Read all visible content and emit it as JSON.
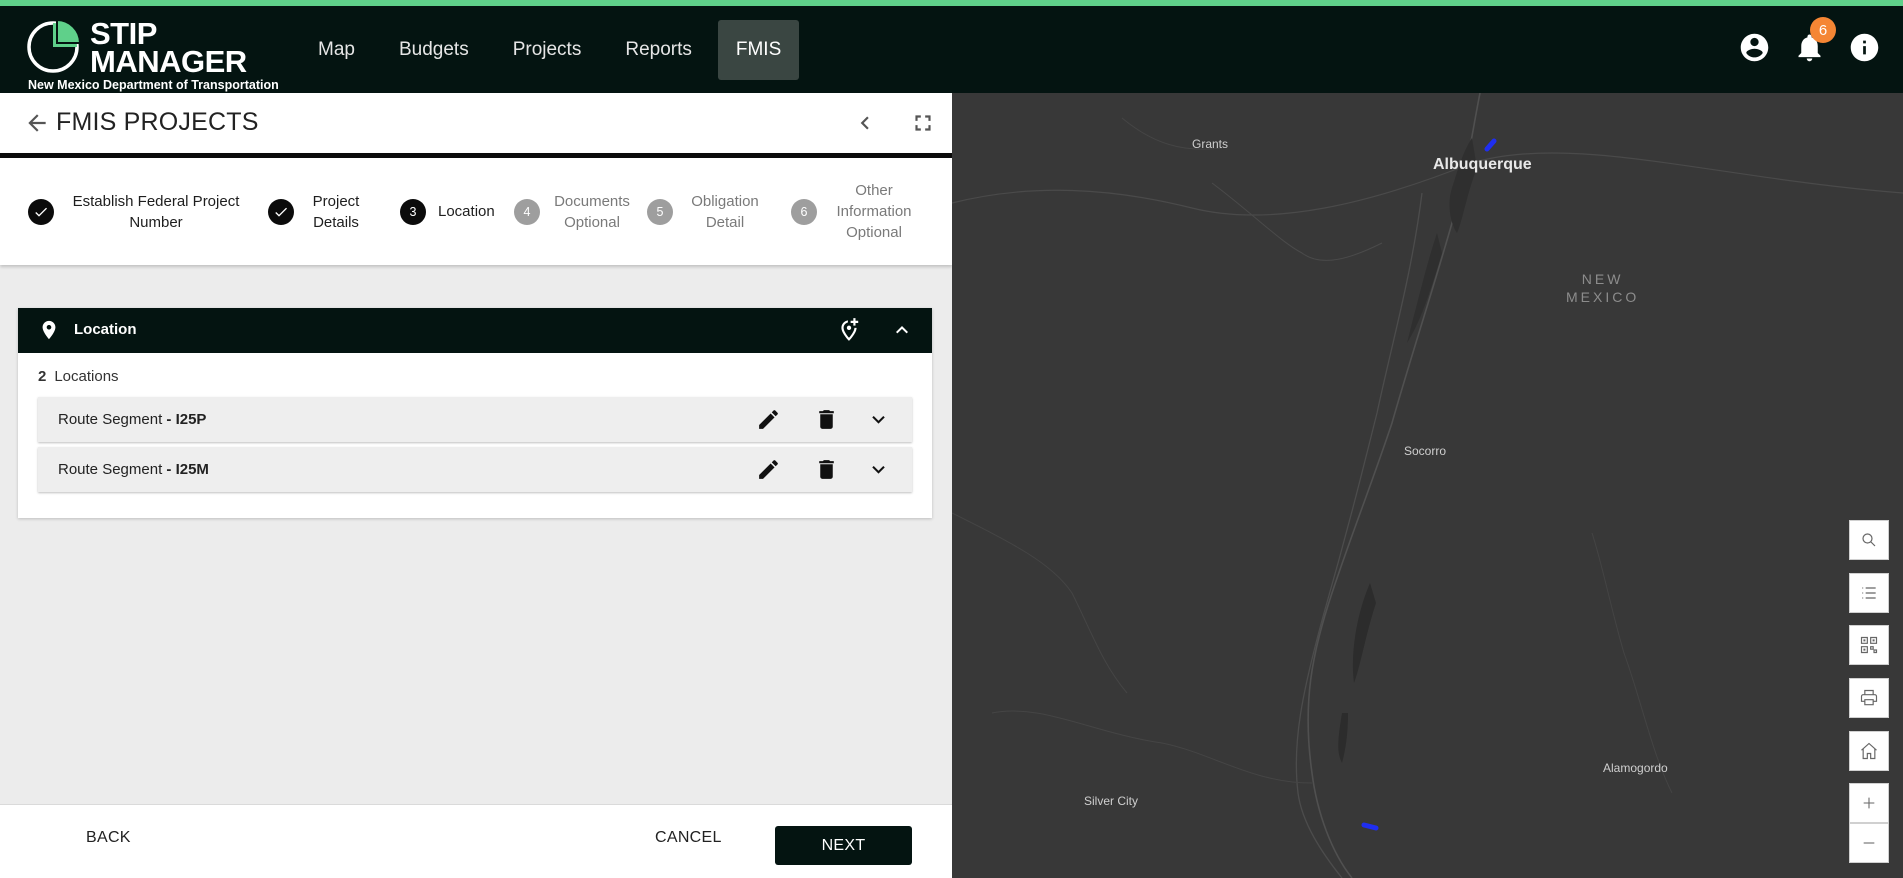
{
  "colors": {
    "brand_dark": "#041411",
    "accent_green": "#5fd08a",
    "badge_orange": "#f58634"
  },
  "app": {
    "logo_title_line1": "STIP",
    "logo_title_line2": "MANAGER",
    "logo_subtitle": "New Mexico Department of Transportation"
  },
  "nav": {
    "items": [
      {
        "label": "Map"
      },
      {
        "label": "Budgets"
      },
      {
        "label": "Projects"
      },
      {
        "label": "Reports"
      },
      {
        "label": "FMIS",
        "active": true
      }
    ]
  },
  "header_icons": {
    "account": "account-circle-icon",
    "notifications": "bell-icon",
    "notification_count": "6",
    "info": "info-icon"
  },
  "panel": {
    "title": "FMIS PROJECTS"
  },
  "steps": [
    {
      "number": "1",
      "label": "Establish Federal Project Number",
      "state": "done"
    },
    {
      "number": "2",
      "label": "Project Details",
      "state": "done"
    },
    {
      "number": "3",
      "label": "Location",
      "state": "current"
    },
    {
      "number": "4",
      "label": "Documents",
      "sub": "Optional",
      "state": "pending"
    },
    {
      "number": "5",
      "label": "Obligation Detail",
      "state": "pending"
    },
    {
      "number": "6",
      "label": "Other Information",
      "sub": "Optional",
      "state": "pending"
    }
  ],
  "location": {
    "header": "Location",
    "count": "2",
    "count_label": "Locations",
    "rows": [
      {
        "prefix": "Route Segment",
        "name": "- I25P"
      },
      {
        "prefix": "Route Segment",
        "name": "- I25M"
      }
    ]
  },
  "footer": {
    "back": "BACK",
    "cancel": "CANCEL",
    "next": "NEXT"
  },
  "map": {
    "labels": {
      "grants": "Grants",
      "albuquerque": "Albuquerque",
      "state_line1": "NEW",
      "state_line2": "MEXICO",
      "socorro": "Socorro",
      "alamogordo": "Alamogordo",
      "silver_city": "Silver City"
    },
    "tools": [
      "search-icon",
      "list-icon",
      "qr-code-icon",
      "print-icon",
      "home-icon",
      "zoom-in-icon",
      "zoom-out-icon"
    ]
  }
}
